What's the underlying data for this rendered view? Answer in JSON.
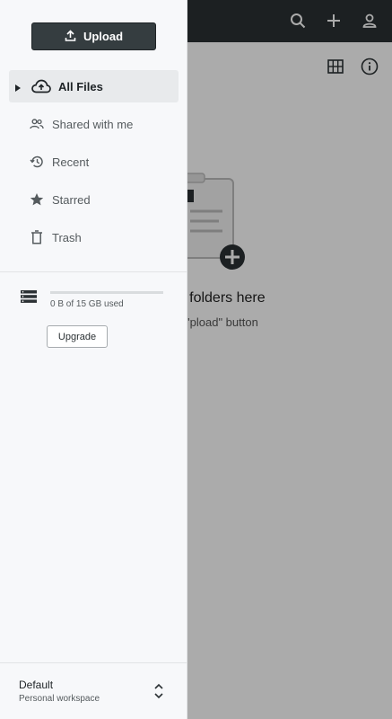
{
  "header": {
    "icons": [
      "search-icon",
      "plus-icon",
      "user-icon"
    ]
  },
  "toolbar": {
    "icons": [
      "grid-view-icon",
      "info-icon"
    ]
  },
  "empty_state": {
    "title": "r folders here",
    "subtitle": "'pload\" button"
  },
  "drawer": {
    "upload_label": "Upload",
    "nav": [
      {
        "label": "All Files",
        "icon": "cloud-upload-icon",
        "active": true
      },
      {
        "label": "Shared with me",
        "icon": "people-icon",
        "active": false
      },
      {
        "label": "Recent",
        "icon": "history-icon",
        "active": false
      },
      {
        "label": "Starred",
        "icon": "star-icon",
        "active": false
      },
      {
        "label": "Trash",
        "icon": "trash-icon",
        "active": false
      }
    ],
    "storage": {
      "used_text": "0 B of 15 GB used",
      "used_fraction": 0.0,
      "upgrade_label": "Upgrade"
    },
    "workspace": {
      "name": "Default",
      "description": "Personal workspace"
    }
  },
  "colors": {
    "header_bg": "#2b3134",
    "drawer_bg": "#f7f8fa",
    "active_item_bg": "#e8eaec",
    "upload_button_bg": "#353d40"
  }
}
